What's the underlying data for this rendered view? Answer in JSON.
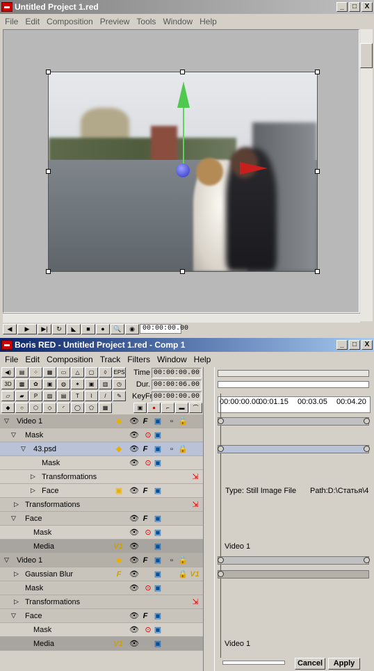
{
  "viewer_window": {
    "title": "Untitled Project 1.red",
    "menu": [
      "File",
      "Edit",
      "Composition",
      "Preview",
      "Tools",
      "Window",
      "Help"
    ],
    "timecode": "00:00:00.00",
    "window_buttons": [
      "_",
      "□",
      "X"
    ]
  },
  "comp_window": {
    "title": "Boris RED - Untitled Project 1.red - Comp 1",
    "menu": [
      "File",
      "Edit",
      "Composition",
      "Track",
      "Filters",
      "Window",
      "Help"
    ],
    "time_label": "Time",
    "time_value": "00:00:00.00",
    "dur_label": "Dur.",
    "dur_value": "00:00:06.00",
    "keyfr_label": "KeyFr.",
    "keyfr_value": "00:00:00.00",
    "ruler_ticks": [
      "00:00:00.00",
      "00:01.15",
      "00:03.05",
      "00:04.20"
    ],
    "tracks": [
      {
        "label": "Video 1"
      },
      {
        "label": "Mask"
      },
      {
        "label": "43.psd"
      },
      {
        "label": "Mask"
      },
      {
        "label": "Transformations"
      },
      {
        "label": "Face"
      },
      {
        "label": "Transformations"
      },
      {
        "label": "Face"
      },
      {
        "label": "Mask"
      },
      {
        "label": "Media",
        "tag": "V1"
      },
      {
        "label": "Video 1"
      },
      {
        "label": "Gaussian Blur",
        "tag": "V1"
      },
      {
        "label": "Mask"
      },
      {
        "label": "Transformations"
      },
      {
        "label": "Face"
      },
      {
        "label": "Mask"
      },
      {
        "label": "Media",
        "tag": "V1"
      }
    ],
    "info_type": "Type: Still Image File",
    "info_path": "Path:D:\\Статья\\4",
    "media_ref_1": "Video 1",
    "media_ref_2": "Video 1",
    "cancel_label": "Cancel",
    "apply_label": "Apply"
  },
  "colors": {
    "title_active": "#0a246a",
    "y_axis": "#4fc84f",
    "x_axis": "#c81e1e",
    "z_sphere": "#2a2ec0"
  }
}
